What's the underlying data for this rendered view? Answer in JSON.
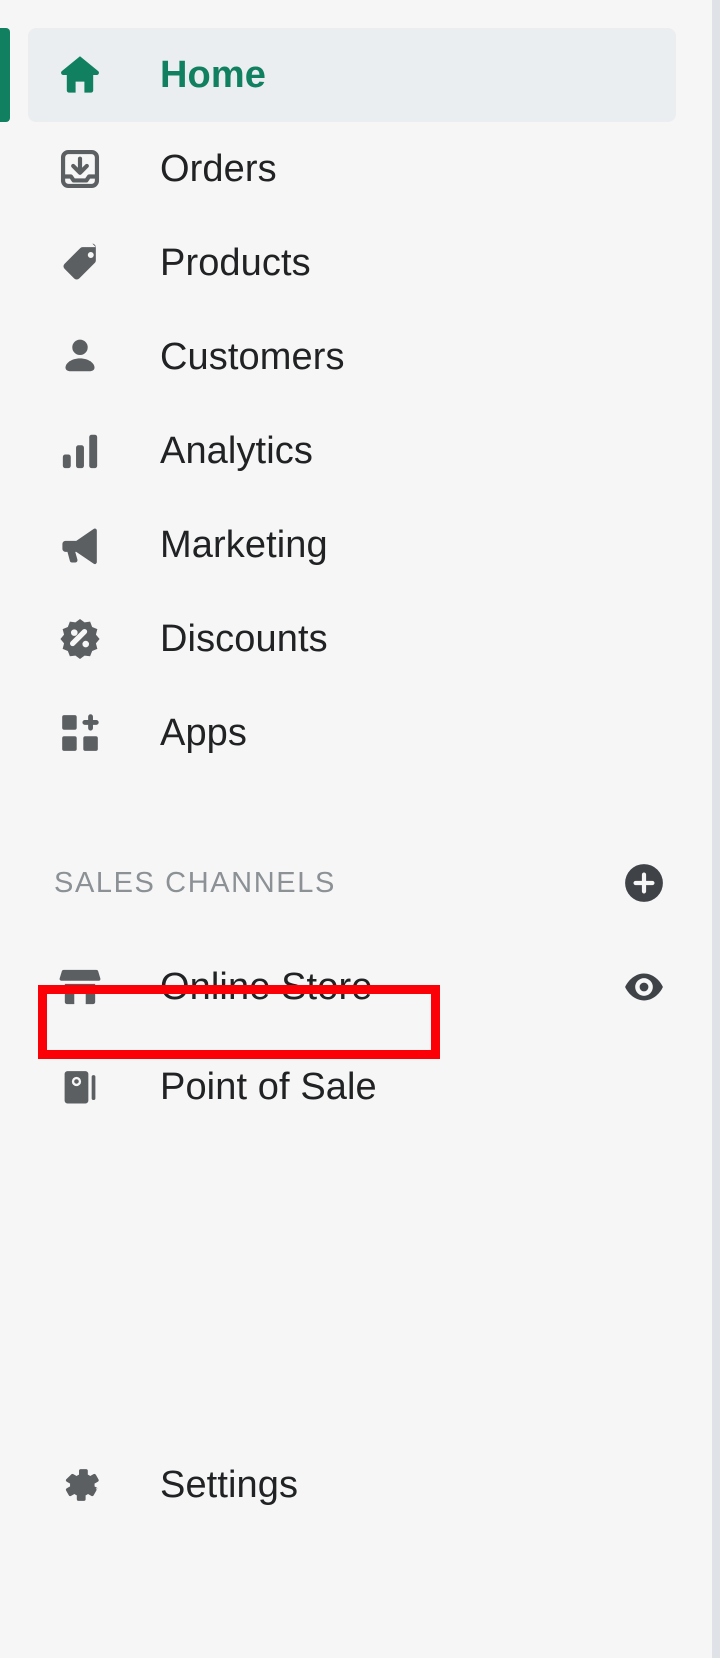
{
  "sidebar": {
    "primary_nav": [
      {
        "label": "Home",
        "icon": "home-icon",
        "active": true
      },
      {
        "label": "Orders",
        "icon": "orders-icon",
        "active": false
      },
      {
        "label": "Products",
        "icon": "products-tag-icon",
        "active": false
      },
      {
        "label": "Customers",
        "icon": "customers-icon",
        "active": false
      },
      {
        "label": "Analytics",
        "icon": "analytics-bar-chart-icon",
        "active": false
      },
      {
        "label": "Marketing",
        "icon": "marketing-megaphone-icon",
        "active": false
      },
      {
        "label": "Discounts",
        "icon": "discounts-percent-badge-icon",
        "active": false
      },
      {
        "label": "Apps",
        "icon": "apps-grid-plus-icon",
        "active": false
      }
    ],
    "sales_channels_section": {
      "title": "SALES CHANNELS",
      "add_action_icon": "plus-circle-icon",
      "channels": [
        {
          "label": "Online Store",
          "icon": "storefront-icon",
          "action_icon": "eye-icon",
          "highlighted": true
        },
        {
          "label": "Point of Sale",
          "icon": "point-of-sale-icon",
          "action_icon": "",
          "highlighted": false
        }
      ]
    },
    "footer_nav": [
      {
        "label": "Settings",
        "icon": "gear-icon"
      }
    ]
  },
  "colors": {
    "background": "#f6f6f7",
    "active_accent": "#108060",
    "active_row": "#ebeef0",
    "text": "#202223",
    "muted_text": "#8c9196",
    "icon": "#5c5f62",
    "annotation": "#fb0007",
    "border": "#dfe3e8"
  },
  "annotation": {
    "target": "Online Store",
    "shape": "rectangle-outline",
    "color": "#fb0007"
  }
}
